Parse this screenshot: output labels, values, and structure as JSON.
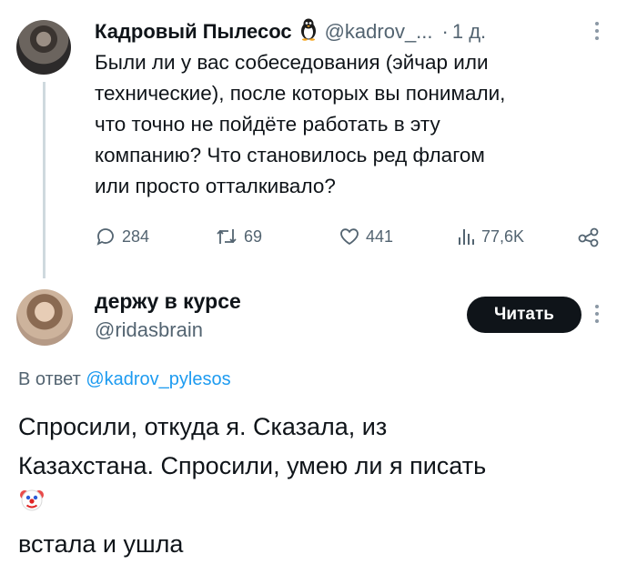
{
  "tweet1": {
    "display_name": "Кадровый Пылесос",
    "name_emoji": "🐧",
    "handle": "@kadrov_...",
    "separator": "·",
    "time": "1 д.",
    "text_lines": [
      "Были ли у вас собеседования (эйчар или",
      "технические), после которых вы понимали,",
      "что точно не пойдёте работать в эту",
      "компанию? Что становилось ред флагом",
      "или просто отталкивало?"
    ],
    "actions": {
      "replies": "284",
      "retweets": "69",
      "likes": "441",
      "views": "77,6K"
    }
  },
  "tweet2": {
    "display_name": "держу в курсе",
    "handle": "@ridasbrain",
    "follow_label": "Читать",
    "reply_prefix": "В ответ",
    "reply_to": "@kadrov_pylesos",
    "text_lines": [
      "Спросили, откуда я. Сказала, из",
      "Казахстана. Спросили, умею ли я писать"
    ],
    "last_line": "встала и ушла",
    "emoji_name": "clown-face-icon"
  },
  "colors": {
    "text": "#0f1419",
    "secondary": "#536471",
    "link": "#1d9bf0",
    "thread_line": "#cfd9de",
    "button_bg": "#0f1419"
  }
}
